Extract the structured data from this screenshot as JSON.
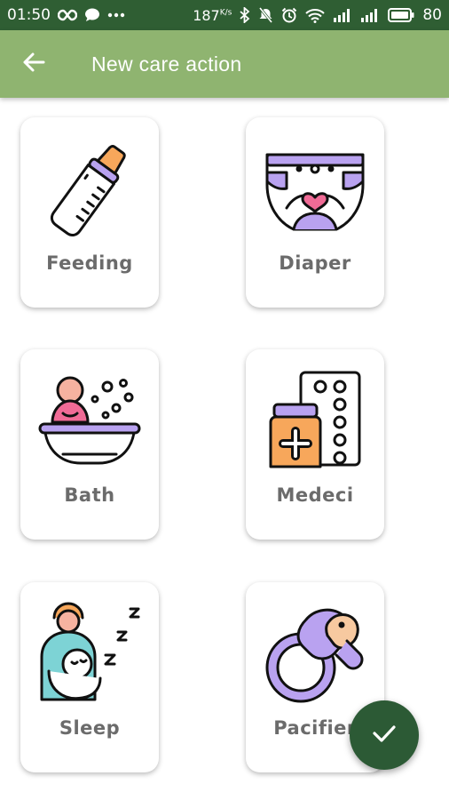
{
  "status_bar": {
    "time": "01:50",
    "network_speed": "187",
    "network_speed_unit": "K/s",
    "battery": "80"
  },
  "app_bar": {
    "title": "New care action",
    "back_icon": "arrow-left-icon"
  },
  "actions": [
    {
      "label": "Feeding",
      "icon": "baby-bottle-icon"
    },
    {
      "label": "Diaper",
      "icon": "diaper-icon"
    },
    {
      "label": "Bath",
      "icon": "bathtub-icon"
    },
    {
      "label": "Medeci",
      "icon": "medicine-icon"
    },
    {
      "label": "Sleep",
      "icon": "sleeping-baby-icon"
    },
    {
      "label": "Pacifier",
      "icon": "pacifier-icon"
    }
  ],
  "fab": {
    "icon": "check-icon"
  },
  "colors": {
    "status_bar": "#2f5e33",
    "app_bar": "#8fb470",
    "fab": "#2c5a35",
    "label_text": "#6b6b6b",
    "accent_purple": "#b9a2f0",
    "accent_pink": "#f06b96",
    "accent_orange": "#f7a75b"
  }
}
